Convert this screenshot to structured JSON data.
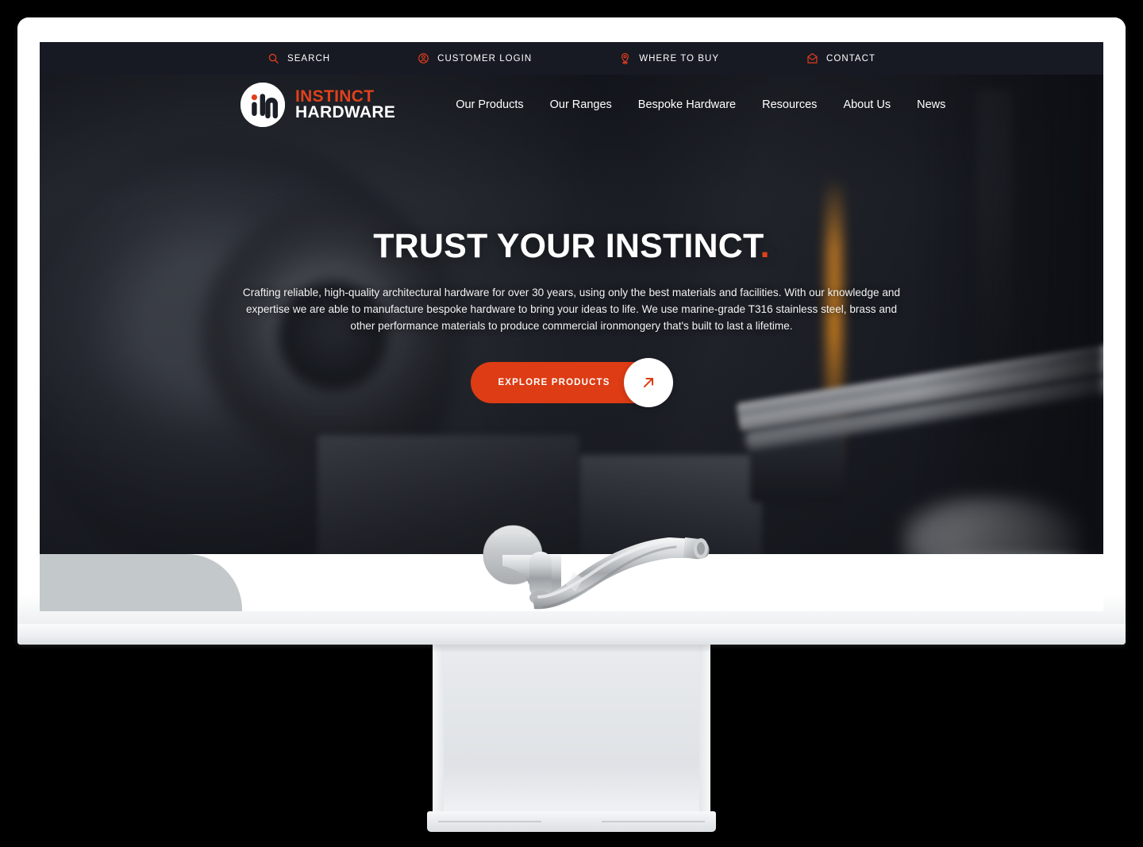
{
  "device": {
    "type": "desktop-monitor-mockup",
    "stand": "pedestal-stand"
  },
  "site": {
    "brand": {
      "name_line1": "INSTINCT",
      "name_line2": "HARDWARE",
      "mark_letters": "ih"
    },
    "colors": {
      "accent": "#dd3c14",
      "accent_logo": "#e0411c",
      "top_bar_bg": "#171a23",
      "hero_bg": "#10131a",
      "grey_panel": "#c3c8ca",
      "text_light": "#ffffff"
    },
    "utility_bar": {
      "items": [
        {
          "label": "SEARCH",
          "icon": "search-icon"
        },
        {
          "label": "CUSTOMER LOGIN",
          "icon": "user-circle-icon"
        },
        {
          "label": "WHERE TO BUY",
          "icon": "map-pin-icon"
        },
        {
          "label": "CONTACT",
          "icon": "envelope-icon"
        }
      ]
    },
    "nav": {
      "items": [
        {
          "label": "Our Products"
        },
        {
          "label": "Our Ranges"
        },
        {
          "label": "Bespoke Hardware"
        },
        {
          "label": "Resources"
        },
        {
          "label": "About Us"
        },
        {
          "label": "News"
        }
      ]
    },
    "hero": {
      "title": "TRUST YOUR INSTINCT",
      "title_punctuation": ".",
      "paragraph": "Crafting reliable, high-quality architectural hardware for over 30 years, using only the best materials and facilities. With our knowledge and expertise we are able to manufacture bespoke hardware to bring your ideas to life. We use marine-grade T316 stainless steel, brass and other performance materials to produce commercial ironmongery that's built to last a lifetime.",
      "cta_label": "EXPLORE PRODUCTS",
      "cta_icon": "arrow-up-right-icon",
      "background_image_description": "blurred machine-shop lathe turning metal bar stock"
    },
    "below_fold": {
      "product_image_alt": "stainless steel lever door handle on round rose"
    }
  }
}
